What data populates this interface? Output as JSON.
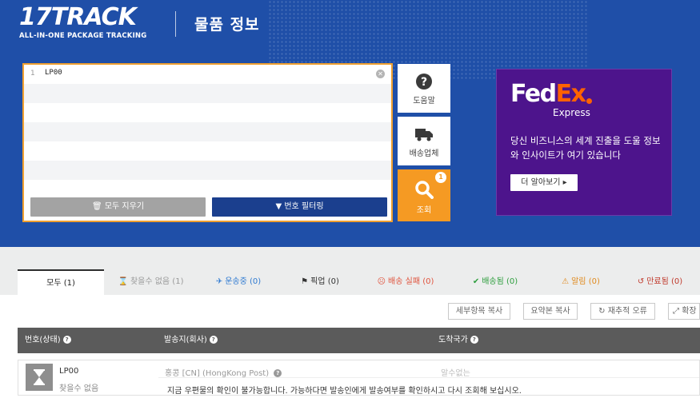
{
  "header": {
    "logo_main": "17TRACK",
    "logo_sub": "ALL-IN-ONE PACKAGE TRACKING",
    "page_title": "물품 정보"
  },
  "input": {
    "line_number": "1",
    "value": "LP00",
    "clear_all_label": "모두 지우기",
    "filter_label": "번호 필터링"
  },
  "side_buttons": {
    "help_label": "도움말",
    "carrier_label": "배송업체",
    "search_label": "조회",
    "search_badge": "1"
  },
  "ad": {
    "brand_fed": "Fed",
    "brand_ex": "Ex",
    "brand_sub": "Express",
    "text": "당신 비즈니스의 세계 진출을 도울 정보와 인사이트가 여기 있습니다",
    "button_label": "더 알아보기 ▸"
  },
  "tabs": [
    {
      "label": "모두 (1)",
      "icon": "",
      "color": "#222222"
    },
    {
      "label": "찾을수 없음 (1)",
      "icon": "hourglass-icon",
      "color": "#999999"
    },
    {
      "label": "운송중 (0)",
      "icon": "plane-icon",
      "color": "#2f7ad1"
    },
    {
      "label": "픽업 (0)",
      "icon": "flag-icon",
      "color": "#333333"
    },
    {
      "label": "배송 실패 (0)",
      "icon": "sad-face-icon",
      "color": "#e0533d"
    },
    {
      "label": "배송됨 (0)",
      "icon": "check-icon",
      "color": "#2e9e3e"
    },
    {
      "label": "알림 (0)",
      "icon": "warning-icon",
      "color": "#e08a1e"
    },
    {
      "label": "만료됨 (0)",
      "icon": "history-icon",
      "color": "#c0392b"
    }
  ],
  "actions": {
    "copy_details": "세부항목 복사",
    "copy_summary": "요약본 복사",
    "retrack_errors": "재추적 오류",
    "expand": "확장"
  },
  "table": {
    "col_number": "번호(상태)",
    "col_origin": "발송지(회사)",
    "col_dest": "도착국가"
  },
  "rows": [
    {
      "number": "LP00",
      "status": "찾을수 없음",
      "origin": "홍콩 [CN] (HongKong Post)",
      "dest": "알수없는",
      "message": "지금 우편물의 확인이 불가능합니다. 가능하다면 발송인에게 발송여부를 확인하시고 다시 조회해 보십시오."
    }
  ]
}
